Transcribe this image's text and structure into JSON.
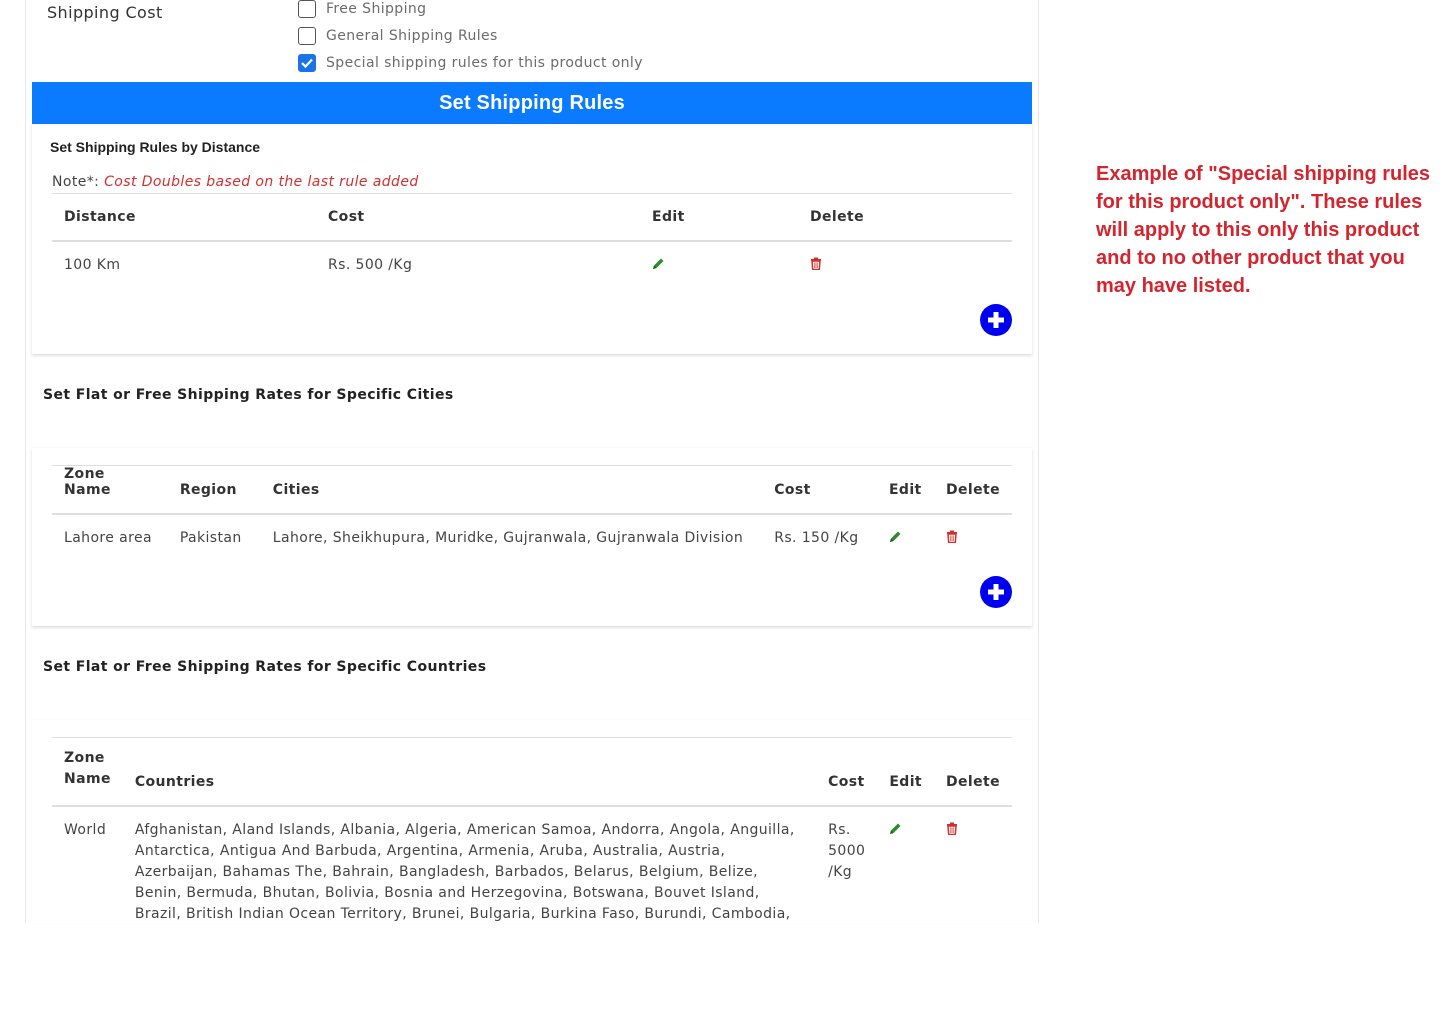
{
  "shipping": {
    "label": "Shipping Cost",
    "options": [
      {
        "label": "Free Shipping",
        "checked": false
      },
      {
        "label": "General Shipping Rules",
        "checked": false
      },
      {
        "label": "Special shipping rules for this product only",
        "checked": true
      }
    ]
  },
  "banner": {
    "title": "Set Shipping Rules"
  },
  "distance": {
    "title": "Set Shipping Rules by Distance",
    "note_prefix": "Note*:",
    "note_text": "Cost Doubles based on the last rule added",
    "headers": {
      "distance": "Distance",
      "cost": "Cost",
      "edit": "Edit",
      "delete": "Delete"
    },
    "rows": [
      {
        "distance": "100 Km",
        "cost": "Rs. 500 /Kg"
      }
    ]
  },
  "cities": {
    "title": "Set Flat or Free Shipping Rates for Specific Cities",
    "headers": {
      "zone": "Zone Name",
      "region": "Region",
      "cities": "Cities",
      "cost": "Cost",
      "edit": "Edit",
      "delete": "Delete"
    },
    "rows": [
      {
        "zone": "Lahore area",
        "region": "Pakistan",
        "cities": "Lahore, Sheikhupura, Muridke, Gujranwala, Gujranwala Division",
        "cost": "Rs. 150 /Kg"
      }
    ]
  },
  "countries": {
    "title": "Set Flat or Free Shipping Rates for Specific Countries",
    "headers": {
      "zone_line1": "Zone",
      "zone_line2": "Name",
      "countries": "Countries",
      "cost": "Cost",
      "edit": "Edit",
      "delete": "Delete"
    },
    "rows": [
      {
        "zone": "World",
        "countries": "Afghanistan, Aland Islands, Albania, Algeria, American Samoa, Andorra, Angola, Anguilla, Antarctica, Antigua And Barbuda, Argentina, Armenia, Aruba, Australia, Austria, Azerbaijan, Bahamas The, Bahrain, Bangladesh, Barbados, Belarus, Belgium, Belize, Benin, Bermuda, Bhutan, Bolivia, Bosnia and Herzegovina, Botswana, Bouvet Island, Brazil, British Indian Ocean Territory, Brunei, Bulgaria, Burkina Faso, Burundi, Cambodia, Cameroon, Canada, Cape Verde, Cayman",
        "cost": "Rs. 5000 /Kg"
      }
    ]
  },
  "callout": {
    "text": "Example of \"Special shipping rules for this product only\".  These rules will apply to this only this product and to no other product that you may have listed."
  },
  "colors": {
    "banner": "#0a7bff",
    "edit_icon": "#2e8b2e",
    "delete_icon": "#d32f2f",
    "add_button": "#0000ee",
    "callout": "#d4252f",
    "note": "#d32f2f"
  }
}
